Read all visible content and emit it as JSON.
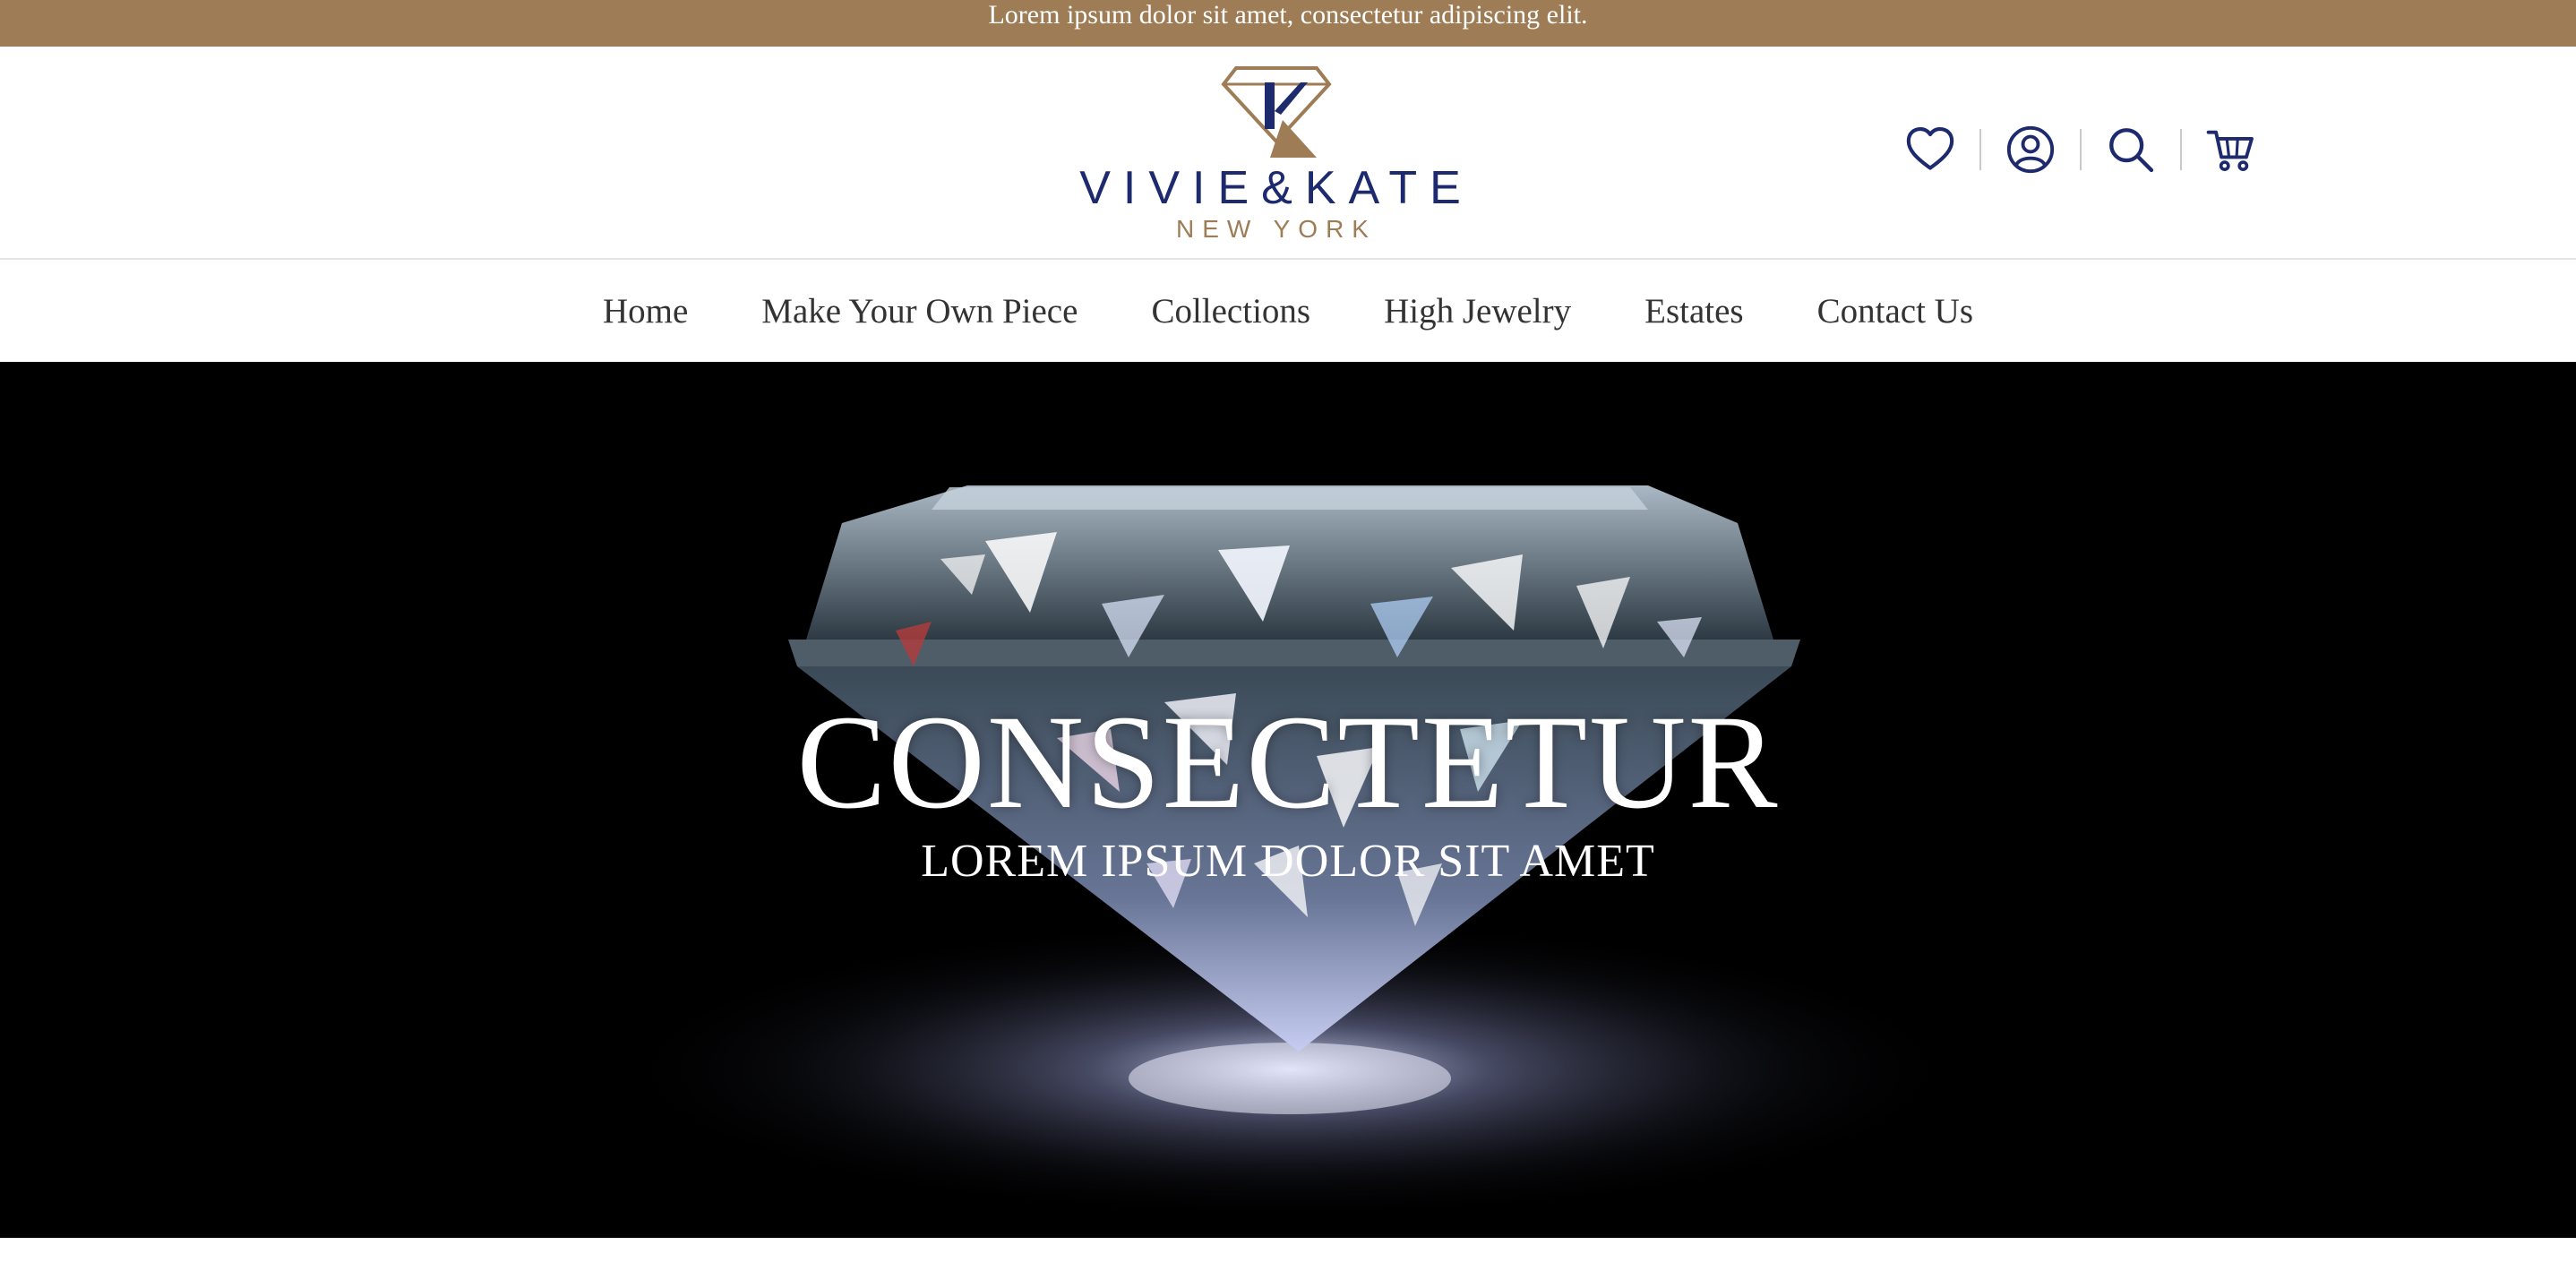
{
  "announcement": {
    "text": "Lorem ipsum dolor sit amet, consectetur adipiscing elit."
  },
  "brand": {
    "name": "VIVIE&KATE",
    "location": "NEW YORK",
    "colors": {
      "navy": "#1e2a6e",
      "gold": "#9e7d56"
    }
  },
  "header_icons": [
    {
      "name": "heart-icon",
      "action": "wishlist"
    },
    {
      "name": "user-icon",
      "action": "account"
    },
    {
      "name": "search-icon",
      "action": "search"
    },
    {
      "name": "cart-icon",
      "action": "cart"
    }
  ],
  "nav": {
    "items": [
      {
        "label": "Home"
      },
      {
        "label": "Make Your Own Piece"
      },
      {
        "label": "Collections"
      },
      {
        "label": "High Jewelry"
      },
      {
        "label": "Estates"
      },
      {
        "label": "Contact Us"
      }
    ]
  },
  "hero": {
    "title": "CONSECTETUR",
    "subtitle": "LOREM IPSUM DOLOR SIT AMET",
    "image": "diamond-image"
  }
}
